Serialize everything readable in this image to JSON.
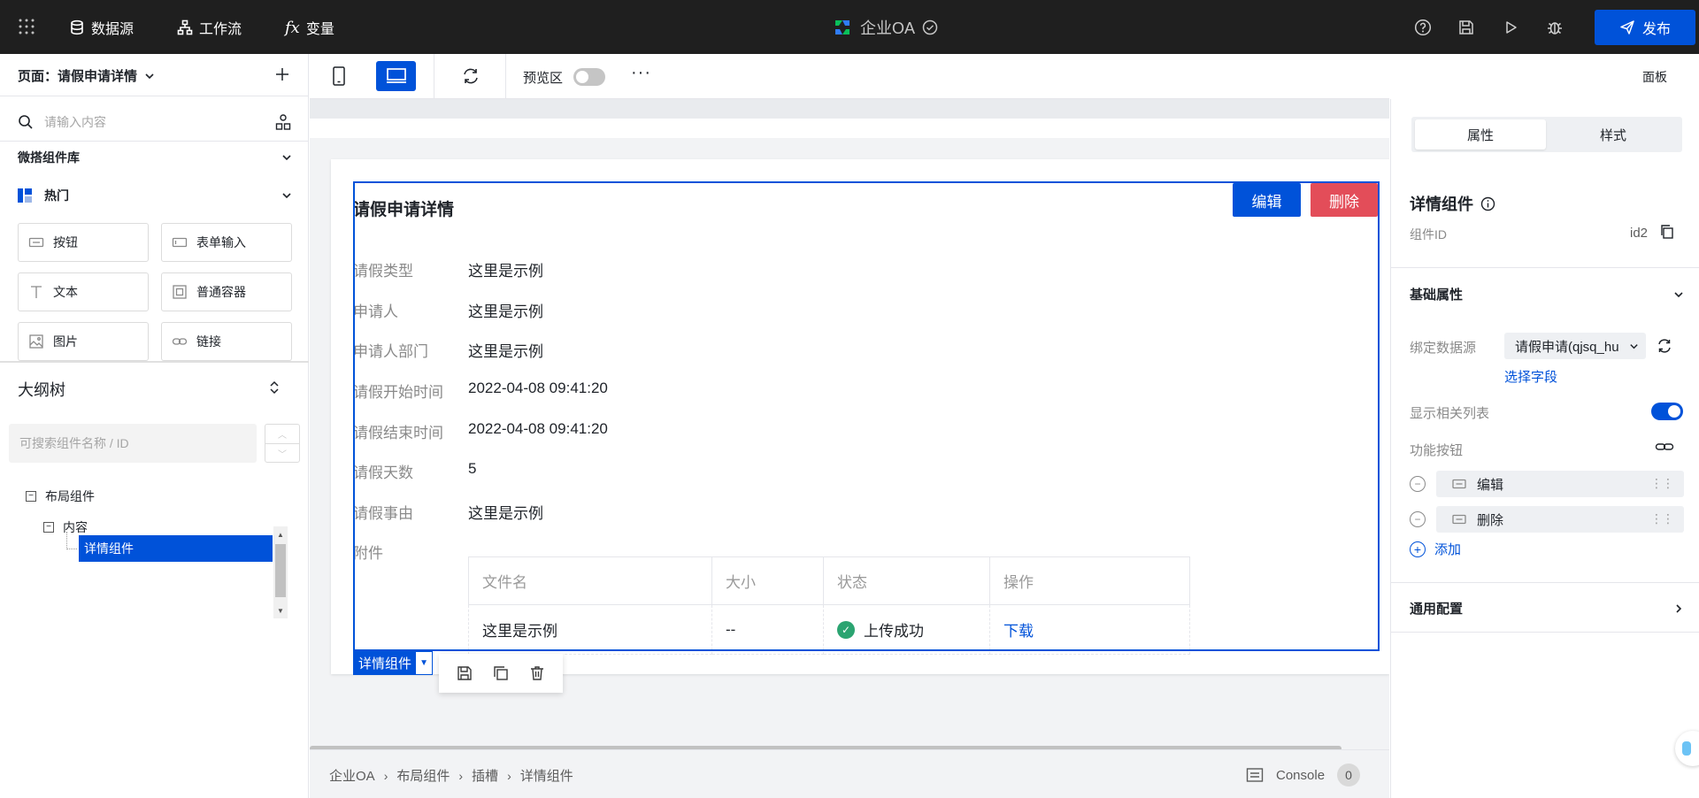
{
  "topbar": {
    "datasource_label": "数据源",
    "workflow_label": "工作流",
    "variables_label": "变量",
    "variables_glyph": "fx",
    "app_title": "企业OA",
    "publish_label": "发布"
  },
  "left_panel": {
    "page_selector": "页面：请假申请详情",
    "search_placeholder": "请输入内容",
    "library_title": "微搭组件库",
    "hot_category": "热门",
    "components": [
      "按钮",
      "表单输入",
      "文本",
      "普通容器",
      "图片",
      "链接"
    ],
    "outline_title": "大纲树",
    "outline_search_placeholder": "可搜索组件名称 / ID",
    "tree": {
      "root": "布局组件",
      "child": "内容",
      "selected": "详情组件"
    }
  },
  "canvas_toolbar": {
    "preview_label": "预览区",
    "preview_enabled": false,
    "more": "···",
    "panel_label": "面板"
  },
  "canvas": {
    "detail_title": "请假申请详情",
    "edit_button": "编辑",
    "delete_button": "删除",
    "fields": [
      {
        "label": "请假类型",
        "value": "这里是示例"
      },
      {
        "label": "申请人",
        "value": "这里是示例"
      },
      {
        "label": "申请人部门",
        "value": "这里是示例"
      },
      {
        "label": "请假开始时间",
        "value": "2022-04-08 09:41:20"
      },
      {
        "label": "请假结束时间",
        "value": "2022-04-08 09:41:20"
      },
      {
        "label": "请假天数",
        "value": "5"
      },
      {
        "label": "请假事由",
        "value": "这里是示例"
      },
      {
        "label": "附件",
        "value": ""
      }
    ],
    "attachment_table": {
      "headers": [
        "文件名",
        "大小",
        "状态",
        "操作"
      ],
      "rows": [
        {
          "name": "这里是示例",
          "size": "--",
          "status": "上传成功",
          "action": "下载"
        }
      ]
    },
    "selection_tag": "详情组件"
  },
  "statusbar": {
    "breadcrumb": [
      "企业OA",
      "布局组件",
      "插槽",
      "详情组件"
    ],
    "console_label": "Console",
    "console_count": "0"
  },
  "right_panel": {
    "tabs": [
      "属性",
      "样式"
    ],
    "active_tab": "属性",
    "component_title": "详情组件",
    "id_label": "组件ID",
    "id_value": "id2",
    "basic_section": "基础属性",
    "datasource_label": "绑定数据源",
    "datasource_value": "请假申请(qjsq_hu",
    "pick_field": "选择字段",
    "show_related_label": "显示相关列表",
    "show_related_enabled": true,
    "func_buttons_label": "功能按钮",
    "func_buttons": [
      "编辑",
      "删除"
    ],
    "add_label": "添加",
    "general_section": "通用配置"
  },
  "colors": {
    "brand": "#0052d9",
    "danger": "#e34d59",
    "success": "#2ba471",
    "topbar_bg": "#1f1f1f"
  }
}
